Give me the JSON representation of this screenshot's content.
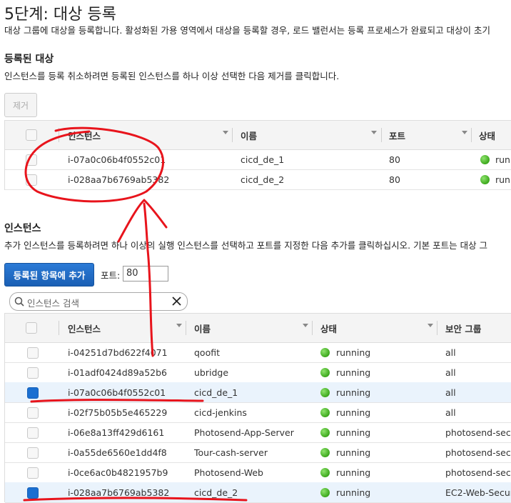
{
  "page": {
    "title": "5단계: 대상 등록",
    "description": "대상 그룹에 대상을 등록합니다. 활성화된 가용 영역에서 대상을 등록할 경우, 로드 밸런서는 등록 프로세스가 완료되고 대상이 초기"
  },
  "registered": {
    "heading": "등록된 대상",
    "description": "인스턴스를 등록 취소하려면 등록된 인스턴스를 하나 이상 선택한 다음 제거를 클릭합니다.",
    "remove_label": "제거",
    "columns": [
      "인스턴스",
      "이름",
      "포트",
      "상태"
    ],
    "rows": [
      {
        "instance": "i-07a0c06b4f0552c01",
        "name": "cicd_de_1",
        "port": "80",
        "status": "runn"
      },
      {
        "instance": "i-028aa7b6769ab5382",
        "name": "cicd_de_2",
        "port": "80",
        "status": "runn"
      }
    ]
  },
  "instances": {
    "heading": "인스턴스",
    "description": "추가 인스턴스를 등록하려면 하나 이상의 실행 인스턴스를 선택하고 포트를 지정한 다음 추가를 클릭하십시오. 기본 포트는 대상 그",
    "add_button": "등록된 항목에 추가",
    "port_label": "포트:",
    "port_value": "80",
    "search_placeholder": "인스턴스 검색",
    "columns": [
      "인스턴스",
      "이름",
      "상태",
      "보안 그룹"
    ],
    "rows": [
      {
        "instance": "i-04251d7bd622f4071",
        "name": "qoofit",
        "status": "running",
        "sg": "all",
        "checked": false
      },
      {
        "instance": "i-01adf0424d89a52b6",
        "name": "ubridge",
        "status": "running",
        "sg": "all",
        "checked": false
      },
      {
        "instance": "i-07a0c06b4f0552c01",
        "name": "cicd_de_1",
        "status": "running",
        "sg": "all",
        "checked": true
      },
      {
        "instance": "i-02f75b05b5e465229",
        "name": "cicd-jenkins",
        "status": "running",
        "sg": "all",
        "checked": false
      },
      {
        "instance": "i-06e8a13ff429d6161",
        "name": "Photosend-App-Server",
        "status": "running",
        "sg": "photosend-secu",
        "checked": false
      },
      {
        "instance": "i-0a55de6560e1dd4f8",
        "name": "Tour-cash-server",
        "status": "running",
        "sg": "photosend-secu",
        "checked": false
      },
      {
        "instance": "i-0ce6ac0b4821957b9",
        "name": "Photosend-Web",
        "status": "running",
        "sg": "photosend-secu",
        "checked": false
      },
      {
        "instance": "i-028aa7b6769ab5382",
        "name": "cicd_de_2",
        "status": "running",
        "sg": "EC2-Web-Secur",
        "checked": true
      }
    ]
  },
  "colors": {
    "accent": "#1a6fd1",
    "annotation": "#e8141c",
    "selected_row": "#eaf3fc",
    "running": "#3ca81c"
  }
}
